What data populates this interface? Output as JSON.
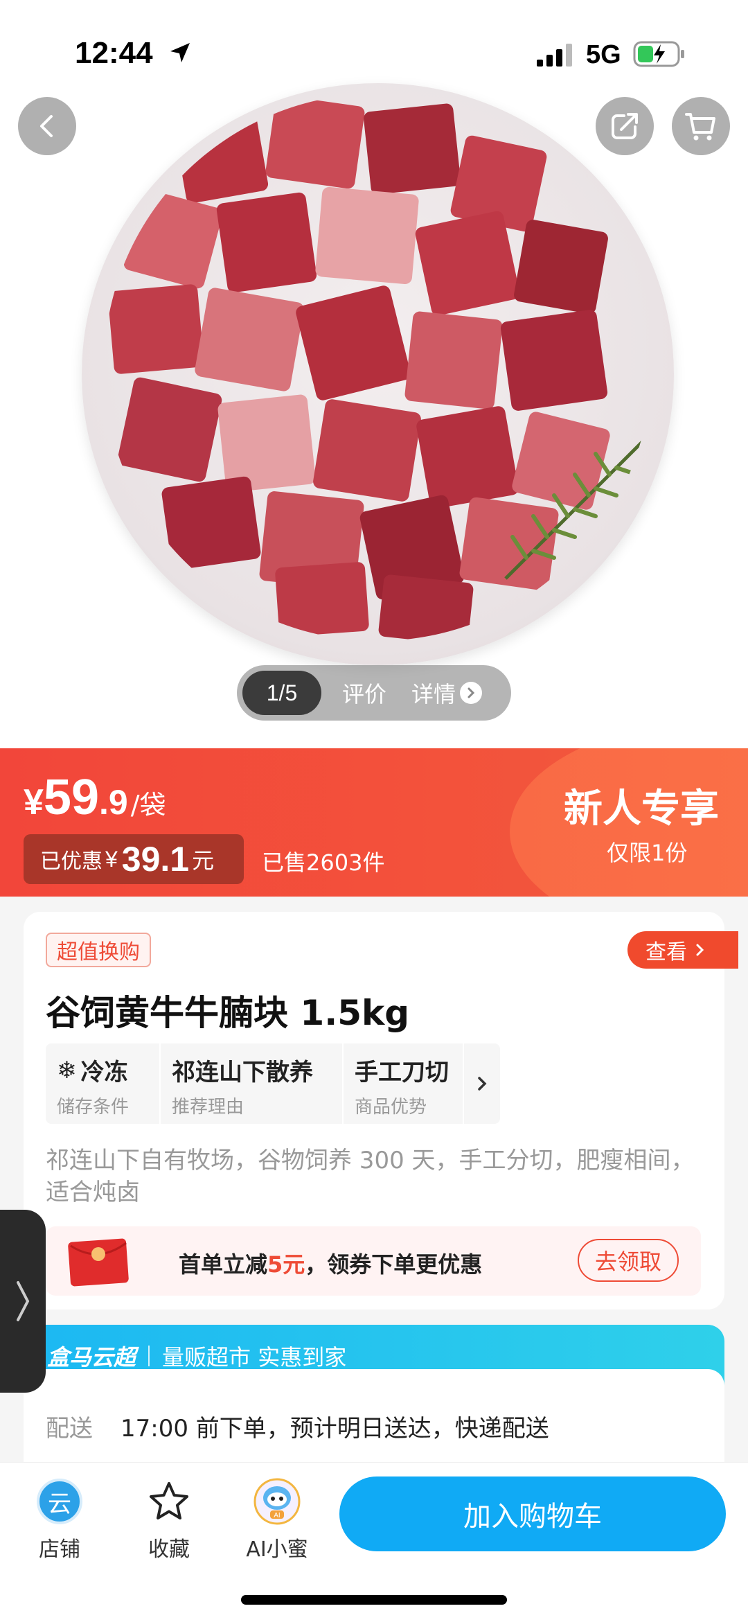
{
  "status_bar": {
    "time": "12:44",
    "network": "5G"
  },
  "gallery": {
    "index": "1/5",
    "tab_reviews": "评价",
    "tab_detail": "详情"
  },
  "price": {
    "symbol": "¥",
    "integer": "59",
    "decimal": ".9",
    "unit": "/袋",
    "discount_prefix": "已优惠",
    "discount_symbol": "¥",
    "discount_value": "39.1",
    "discount_unit": "元",
    "sold": "已售2603件",
    "promo_title": "新人专享",
    "promo_sub": "仅限1份"
  },
  "product": {
    "tag": "超值换购",
    "view_label": "查看",
    "title": "谷饲黄牛牛腩块 1.5kg",
    "attributes": [
      {
        "value": "冷冻",
        "key": "储存条件"
      },
      {
        "value": "祁连山下散养",
        "key": "推荐理由"
      },
      {
        "value": "手工刀切",
        "key": "商品优势"
      }
    ],
    "description": "祁连山下自有牧场，谷物饲养 300 天，手工分切，肥瘦相间，适合炖卤"
  },
  "coupon": {
    "text_before": "首单立减",
    "amount": "5元",
    "text_after": "，领券下单更优惠",
    "button": "去领取"
  },
  "hema": {
    "brand": "盒马云超",
    "slogan": "量贩超市 实惠到家"
  },
  "delivery": {
    "label": "配送",
    "text": "17:00 前下单，预计明日送达，快递配送"
  },
  "bottom_bar": {
    "store_label": "店铺",
    "store_icon_text": "云",
    "fav_label": "收藏",
    "ai_label": "AI小蜜",
    "cart_button": "加入购物车"
  },
  "colors": {
    "price_red": "#f2463a",
    "accent_blue": "#10aaf5",
    "hema_cyan": "#1cb8f2"
  }
}
